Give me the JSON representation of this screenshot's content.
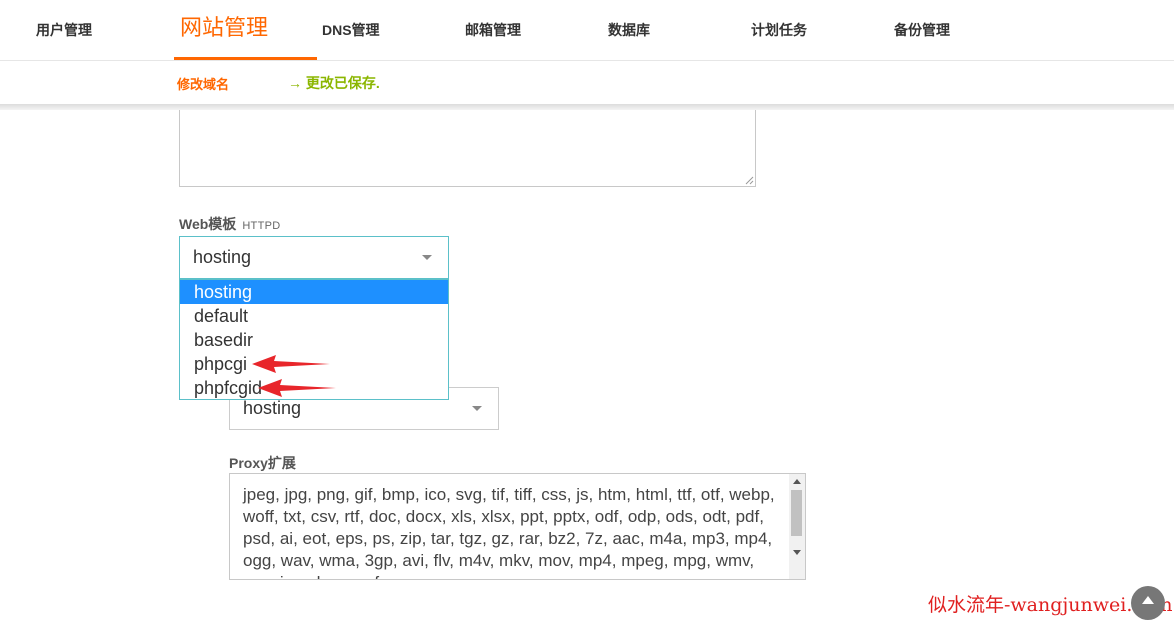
{
  "nav": {
    "tabs": [
      {
        "label": "用户管理"
      },
      {
        "label": "网站管理"
      },
      {
        "label": "DNS管理"
      },
      {
        "label": "邮箱管理"
      },
      {
        "label": "数据库"
      },
      {
        "label": "计划任务"
      },
      {
        "label": "备份管理"
      }
    ],
    "active_index": 1
  },
  "subnav": {
    "link": "修改域名",
    "message": "→ 更改已保存."
  },
  "form": {
    "web_template": {
      "label": "Web模板",
      "sub_label": "HTTPD",
      "value": "hosting",
      "options": [
        "hosting",
        "default",
        "basedir",
        "phpcgi",
        "phpfcgid"
      ],
      "selected_option": "hosting"
    },
    "proxy_template": {
      "value": "hosting"
    },
    "proxy_extensions": {
      "label": "Proxy扩展",
      "value": "jpeg, jpg, png, gif, bmp, ico, svg, tif, tiff, css, js, htm, html, ttf, otf, webp, woff, txt, csv, rtf, doc, docx, xls, xlsx, ppt, pptx, odf, odp, ods, odt, pdf, psd, ai, eot, eps, ps, zip, tar, tgz, gz, rar, bz2, 7z, aac, m4a, mp3, mp4, ogg, wav, wma, 3gp, avi, flv, m4v, mkv, mov, mp4, mpeg, mpg, wmv, exe, iso, dmg, swf"
    }
  },
  "watermark": "似水流年-wangjunwei.com",
  "colors": {
    "accent": "#ff6701",
    "success": "#8bb600",
    "selection": "#1e90ff",
    "arrow": "#e8262b"
  }
}
